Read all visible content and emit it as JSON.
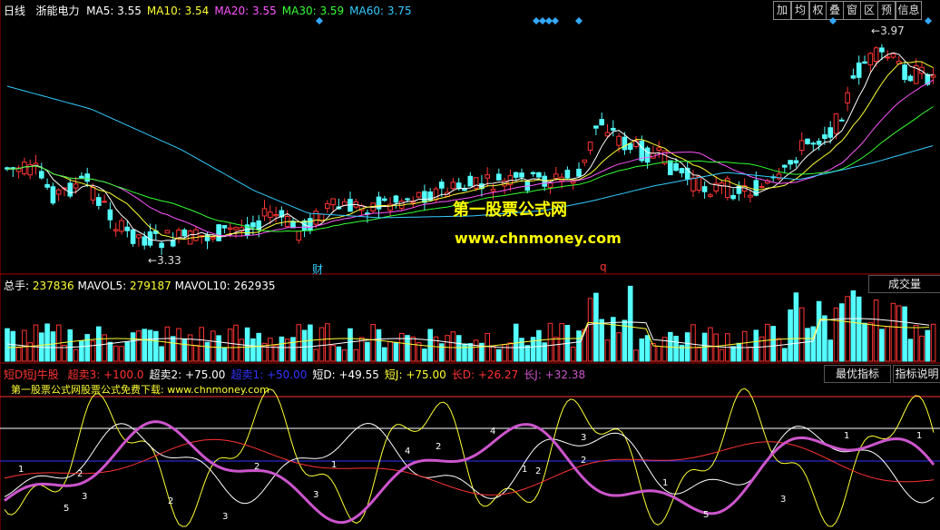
{
  "header": {
    "period": "日线",
    "stock_name": "浙能电力",
    "ma": [
      {
        "label": "MA5:",
        "value": "3.55",
        "color": "#ffffff"
      },
      {
        "label": "MA10:",
        "value": "3.54",
        "color": "#ffff33"
      },
      {
        "label": "MA20:",
        "value": "3.55",
        "color": "#ff55ff"
      },
      {
        "label": "MA30:",
        "value": "3.59",
        "color": "#33ff33"
      },
      {
        "label": "MA60:",
        "value": "3.75",
        "color": "#33ccff"
      }
    ]
  },
  "toolbar": [
    "加",
    "均",
    "权",
    "叠",
    "窗",
    "区",
    "预",
    "信息"
  ],
  "price_panel": {
    "high_label": "3.97",
    "low_label": "3.33",
    "marker_cai": "财",
    "marker_q": "q",
    "watermark_title": "第一股票公式网",
    "watermark_url": "www.chnmoney.com"
  },
  "volume_panel": {
    "label": "总手:",
    "value": "237836",
    "mavol5_label": "MAVOL5:",
    "mavol5_value": "279187",
    "mavol10_label": "MAVOL10:",
    "mavol10_value": "262935",
    "button": "成交量"
  },
  "indicator_panel": {
    "name": "短D短J牛股",
    "items": [
      {
        "label": "超卖3:",
        "value": "+100.0",
        "color": "#ff3333"
      },
      {
        "label": "超卖2:",
        "value": "+75.00",
        "color": "#ffffff"
      },
      {
        "label": "超卖1:",
        "value": "+50.00",
        "color": "#3333ff"
      },
      {
        "label": "短D:",
        "value": "+49.55",
        "color": "#ffffff"
      },
      {
        "label": "短J:",
        "value": "+75.00",
        "color": "#ffff33"
      },
      {
        "label": "长D:",
        "value": "+26.27",
        "color": "#ff3333"
      },
      {
        "label": "长J:",
        "value": "+32.38",
        "color": "#cc55cc"
      }
    ],
    "btn_best": "最优指标",
    "btn_help": "指标说明",
    "subtitle": "第一股票公式网股票公式免费下载: www.chnmoney.com"
  },
  "colors": {
    "up": "#ff3333",
    "down": "#54ffff",
    "ma5": "#ffffff",
    "ma10": "#ffff33",
    "ma20": "#ff55ff",
    "ma30": "#33ff33",
    "ma60": "#33ccff",
    "watermark": "#ffff00"
  }
}
